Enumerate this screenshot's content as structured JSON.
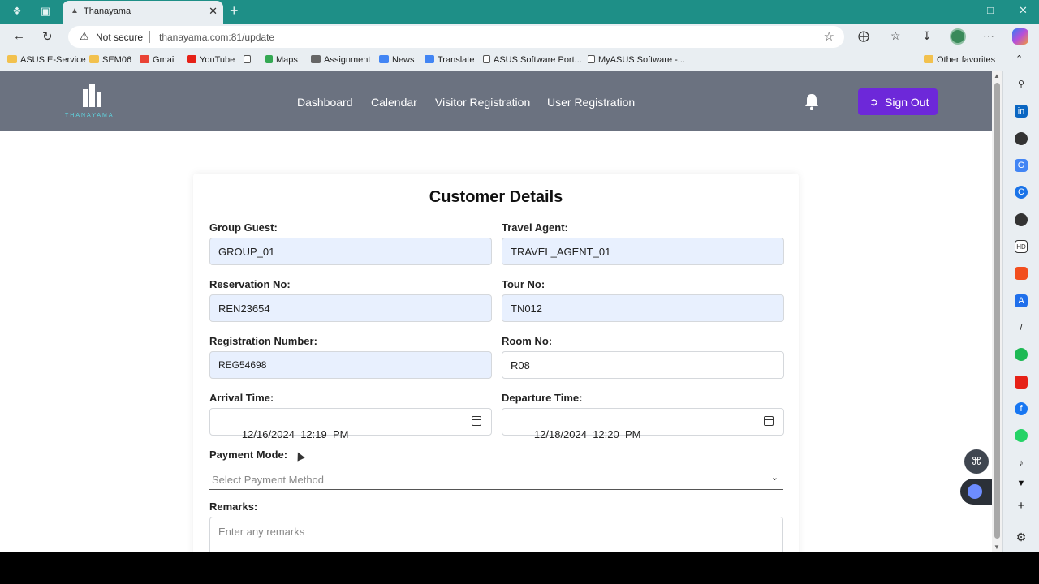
{
  "browser": {
    "tab_title": "Thanayama",
    "not_secure": "Not secure",
    "url": "thanayama.com:81/update",
    "bookmarks": [
      "ASUS E-Service",
      "SEM06",
      "Gmail",
      "YouTube",
      "",
      "Maps",
      "Assignment",
      "News",
      "Translate",
      "ASUS Software Port...",
      "MyASUS Software -..."
    ],
    "other_favorites": "Other favorites"
  },
  "header": {
    "logo_text": "THANAYAMA",
    "nav": [
      "Dashboard",
      "Calendar",
      "Visitor Registration",
      "User Registration"
    ],
    "signout": "Sign Out"
  },
  "form": {
    "title": "Customer Details",
    "group_guest": {
      "label": "Group Guest:",
      "value": "GROUP_01"
    },
    "travel_agent": {
      "label": "Travel Agent:",
      "value": "TRAVEL_AGENT_01"
    },
    "reservation_no": {
      "label": "Reservation No:",
      "value": "REN23654"
    },
    "tour_no": {
      "label": "Tour No:",
      "value": "TN012"
    },
    "registration_number": {
      "label": "Registration Number:",
      "value": "REG54698"
    },
    "room_no": {
      "label": "Room No:",
      "value": "R08"
    },
    "arrival_time": {
      "label": "Arrival Time:",
      "value": "12/16/2024  12:19  PM"
    },
    "departure_time": {
      "label": "Departure Time:",
      "value": "12/18/2024  12:20  PM"
    },
    "payment_mode": {
      "label": "Payment Mode:",
      "placeholder": "Select Payment Method"
    },
    "remarks": {
      "label": "Remarks:",
      "placeholder": "Enter any remarks"
    }
  },
  "colors": {
    "tab_bar": "#1e8f87",
    "header": "#6b7280",
    "signout": "#6d28d9",
    "filled_field": "#e8f0fe"
  }
}
